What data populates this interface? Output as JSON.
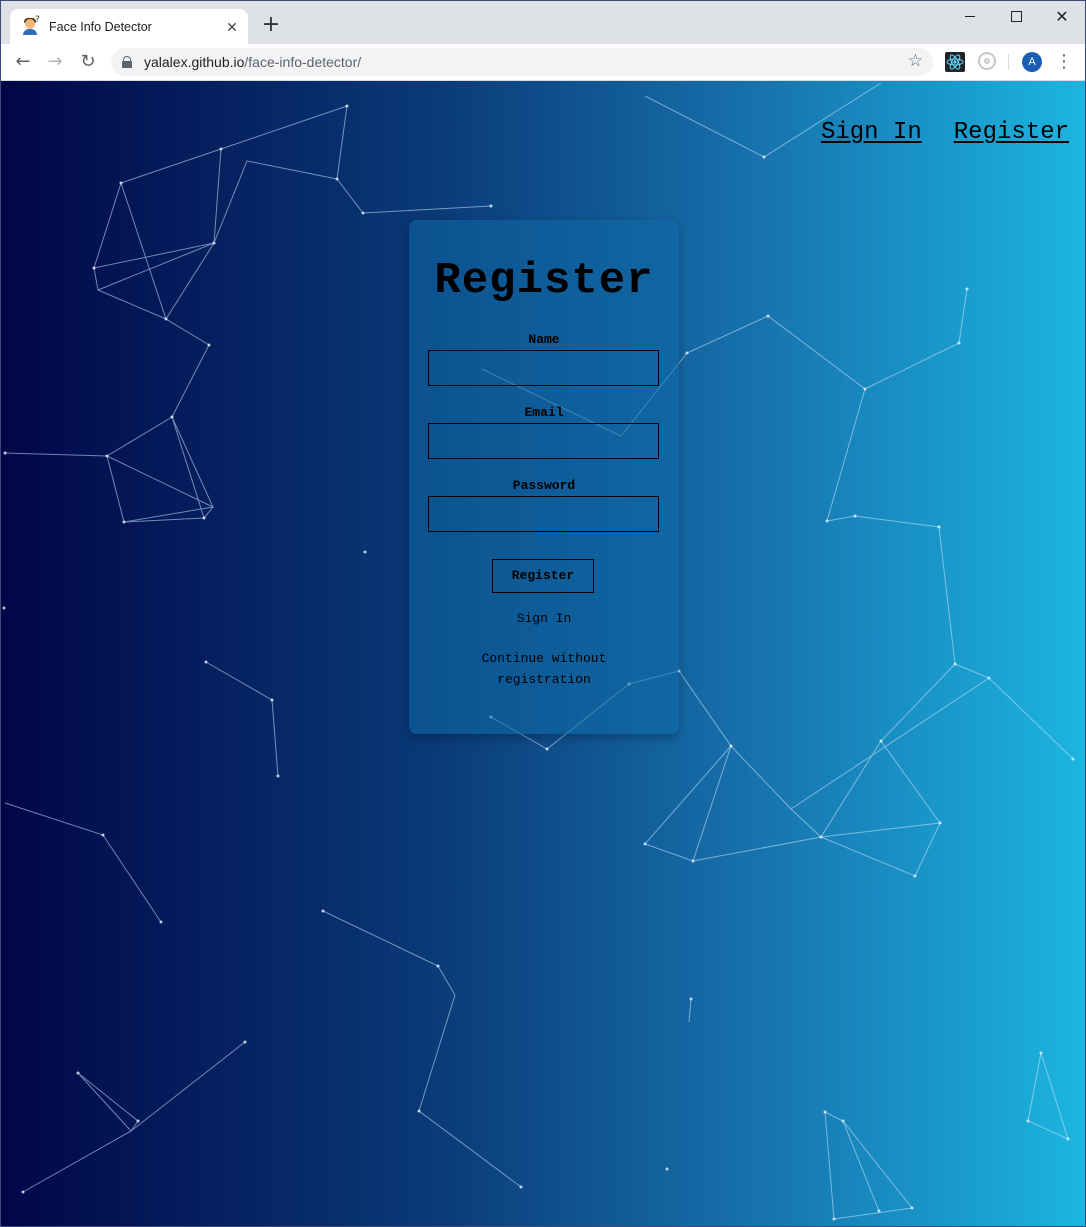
{
  "browser": {
    "tab_title": "Face Info Detector",
    "tab_close": "✕",
    "new_tab": "+",
    "url_host": "yalalex.github.io",
    "url_path": "/face-info-detector/",
    "profile_initial": "A",
    "icons": {
      "back": "←",
      "forward": "→",
      "reload": "↻",
      "star": "☆",
      "menu": "⋮",
      "close": "✕"
    }
  },
  "nav": {
    "sign_in": "Sign In",
    "register": "Register"
  },
  "form": {
    "title": "Register",
    "name_label": "Name",
    "name_value": "",
    "email_label": "Email",
    "email_value": "",
    "password_label": "Password",
    "password_value": "",
    "submit_label": "Register",
    "sign_in_link": "Sign In",
    "continue_link": "Continue without registration"
  },
  "colors": {
    "gradient_start": "#010648",
    "gradient_end": "#1cb5e0",
    "particle_line": "#cfe6ff"
  }
}
